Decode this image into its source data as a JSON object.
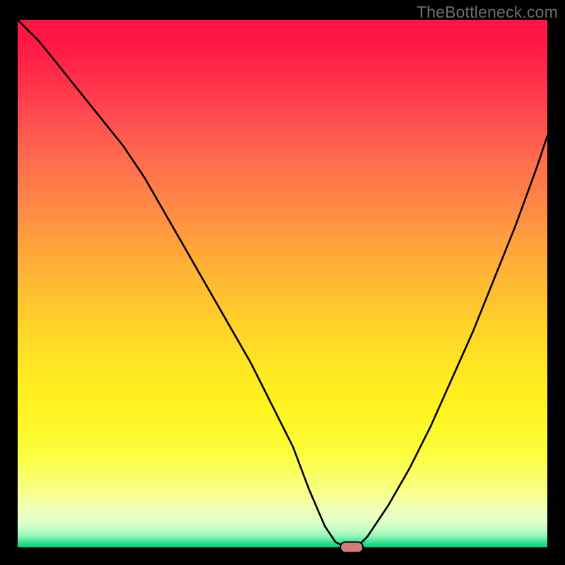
{
  "watermark": "TheBottleneck.com",
  "chart_data": {
    "type": "line",
    "title": "",
    "xlabel": "",
    "ylabel": "",
    "xlim": [
      0,
      100
    ],
    "ylim": [
      0,
      100
    ],
    "x": [
      0,
      4,
      8,
      12,
      16,
      20,
      24,
      28,
      32,
      36,
      40,
      44,
      48,
      52,
      55,
      58,
      60,
      62,
      64,
      66,
      70,
      74,
      78,
      82,
      86,
      90,
      94,
      98,
      100
    ],
    "values": [
      100,
      96,
      91,
      86,
      81,
      76,
      70,
      63,
      56,
      49,
      42,
      35,
      27,
      19,
      11,
      4,
      1,
      0,
      0,
      2,
      8,
      15,
      23,
      32,
      41,
      51,
      61,
      72,
      78
    ],
    "minimum": {
      "x": 63,
      "y": 0
    },
    "background_gradient": {
      "top_color": "#ff1744",
      "bottom_color": "#00d57a",
      "mid_yellow_at": 0.6
    }
  },
  "marker": {
    "shape": "rounded-pill",
    "fill": "#d47a7a",
    "stroke": "#000000"
  }
}
